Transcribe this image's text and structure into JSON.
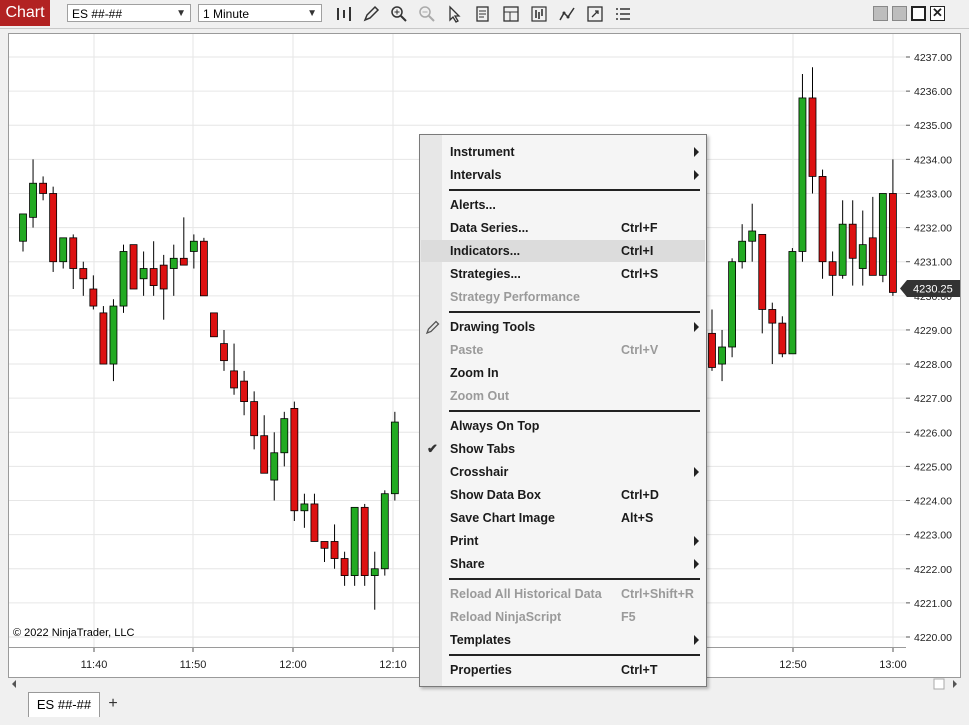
{
  "window": {
    "title": "Chart",
    "instrument": "ES ##-##",
    "interval": "1 Minute"
  },
  "toolbar": {
    "tools": [
      "bar-type-icon",
      "pencil-icon",
      "zoom-in-icon",
      "zoom-out-icon",
      "pointer-icon",
      "data-box-icon",
      "chart-panels-icon",
      "chart-style-icon",
      "indicators-icon",
      "properties-icon",
      "menu-icon"
    ]
  },
  "chart": {
    "copyright": "© 2022 NinjaTrader, LLC",
    "current_price": "4230.25",
    "colors": {
      "up": "#22aa22",
      "down": "#dd1111",
      "marker": "#333333"
    }
  },
  "chart_data": {
    "type": "candlestick",
    "instrument": "ES ##-##",
    "interval": "1 Minute",
    "x_ticks": [
      "11:40",
      "11:50",
      "12:00",
      "12:10",
      "12:50",
      "13:00"
    ],
    "y_ticks": [
      "4237.00",
      "4236.00",
      "4235.00",
      "4234.00",
      "4233.00",
      "4232.00",
      "4231.00",
      "4230.00",
      "4229.00",
      "4228.00",
      "4227.00",
      "4226.00",
      "4225.00",
      "4224.00",
      "4223.00",
      "4222.00",
      "4221.00",
      "4220.00"
    ],
    "ylim": [
      4219.8,
      4237.4
    ],
    "last_price": 4230.25,
    "candles": [
      {
        "o": 4231.6,
        "h": 4232.3,
        "l": 4231.3,
        "c": 4232.4
      },
      {
        "o": 4232.3,
        "h": 4234.0,
        "l": 4232.0,
        "c": 4233.3
      },
      {
        "o": 4233.3,
        "h": 4233.5,
        "l": 4232.8,
        "c": 4233.0
      },
      {
        "o": 4233.0,
        "h": 4233.2,
        "l": 4230.7,
        "c": 4231.0
      },
      {
        "o": 4231.0,
        "h": 4231.6,
        "l": 4230.8,
        "c": 4231.7
      },
      {
        "o": 4231.7,
        "h": 4231.8,
        "l": 4230.2,
        "c": 4230.8
      },
      {
        "o": 4230.8,
        "h": 4231.0,
        "l": 4230.0,
        "c": 4230.5
      },
      {
        "o": 4230.2,
        "h": 4230.6,
        "l": 4229.6,
        "c": 4229.7
      },
      {
        "o": 4229.5,
        "h": 4229.7,
        "l": 4228.0,
        "c": 4228.0
      },
      {
        "o": 4228.0,
        "h": 4229.9,
        "l": 4227.5,
        "c": 4229.7
      },
      {
        "o": 4229.7,
        "h": 4231.5,
        "l": 4229.5,
        "c": 4231.3
      },
      {
        "o": 4231.5,
        "h": 4231.5,
        "l": 4230.2,
        "c": 4230.2
      },
      {
        "o": 4230.5,
        "h": 4231.3,
        "l": 4230.0,
        "c": 4230.8
      },
      {
        "o": 4230.8,
        "h": 4231.6,
        "l": 4230.0,
        "c": 4230.3
      },
      {
        "o": 4230.9,
        "h": 4231.2,
        "l": 4229.3,
        "c": 4230.2
      },
      {
        "o": 4230.8,
        "h": 4231.5,
        "l": 4230.0,
        "c": 4231.1
      },
      {
        "o": 4231.1,
        "h": 4232.3,
        "l": 4231.0,
        "c": 4230.9
      },
      {
        "o": 4231.3,
        "h": 4231.8,
        "l": 4230.8,
        "c": 4231.6
      },
      {
        "o": 4231.6,
        "h": 4231.7,
        "l": 4230.0,
        "c": 4230.0
      },
      {
        "o": 4229.5,
        "h": 4229.5,
        "l": 4228.8,
        "c": 4228.8
      },
      {
        "o": 4228.6,
        "h": 4229.0,
        "l": 4227.8,
        "c": 4228.1
      },
      {
        "o": 4227.8,
        "h": 4228.6,
        "l": 4227.1,
        "c": 4227.3
      },
      {
        "o": 4227.5,
        "h": 4227.8,
        "l": 4226.5,
        "c": 4226.9
      },
      {
        "o": 4226.9,
        "h": 4227.2,
        "l": 4225.5,
        "c": 4225.9
      },
      {
        "o": 4225.9,
        "h": 4226.5,
        "l": 4224.8,
        "c": 4224.8
      },
      {
        "o": 4224.6,
        "h": 4226.0,
        "l": 4224.0,
        "c": 4225.4
      },
      {
        "o": 4225.4,
        "h": 4226.6,
        "l": 4225.0,
        "c": 4226.4
      },
      {
        "o": 4226.7,
        "h": 4226.9,
        "l": 4223.4,
        "c": 4223.7
      },
      {
        "o": 4223.7,
        "h": 4224.2,
        "l": 4223.2,
        "c": 4223.9
      },
      {
        "o": 4223.9,
        "h": 4224.2,
        "l": 4222.8,
        "c": 4222.8
      },
      {
        "o": 4222.8,
        "h": 4222.8,
        "l": 4222.2,
        "c": 4222.6
      },
      {
        "o": 4222.8,
        "h": 4223.3,
        "l": 4222.0,
        "c": 4222.3
      },
      {
        "o": 4222.3,
        "h": 4222.5,
        "l": 4221.5,
        "c": 4221.8
      },
      {
        "o": 4221.8,
        "h": 4223.8,
        "l": 4221.5,
        "c": 4223.8
      },
      {
        "o": 4223.8,
        "h": 4223.9,
        "l": 4221.5,
        "c": 4221.8
      },
      {
        "o": 4221.8,
        "h": 4222.5,
        "l": 4220.8,
        "c": 4222.0
      },
      {
        "o": 4222.0,
        "h": 4224.3,
        "l": 4221.8,
        "c": 4224.2
      },
      {
        "o": 4224.2,
        "h": 4226.6,
        "l": 4224.0,
        "c": 4226.3
      },
      {
        "o": 4228.9,
        "h": 4229.6,
        "l": 4227.8,
        "c": 4227.9
      },
      {
        "o": 4228.0,
        "h": 4229.0,
        "l": 4227.5,
        "c": 4228.5
      },
      {
        "o": 4228.5,
        "h": 4231.1,
        "l": 4228.2,
        "c": 4231.0
      },
      {
        "o": 4231.0,
        "h": 4232.1,
        "l": 4230.8,
        "c": 4231.6
      },
      {
        "o": 4231.6,
        "h": 4232.7,
        "l": 4231.0,
        "c": 4231.9
      },
      {
        "o": 4231.8,
        "h": 4231.8,
        "l": 4228.9,
        "c": 4229.6
      },
      {
        "o": 4229.6,
        "h": 4229.8,
        "l": 4228.0,
        "c": 4229.2
      },
      {
        "o": 4229.2,
        "h": 4229.4,
        "l": 4228.2,
        "c": 4228.3
      },
      {
        "o": 4228.3,
        "h": 4231.4,
        "l": 4228.3,
        "c": 4231.3
      },
      {
        "o": 4231.3,
        "h": 4236.5,
        "l": 4231.0,
        "c": 4235.8
      },
      {
        "o": 4235.8,
        "h": 4236.7,
        "l": 4233.0,
        "c": 4233.5
      },
      {
        "o": 4233.5,
        "h": 4233.7,
        "l": 4230.5,
        "c": 4231.0
      },
      {
        "o": 4231.0,
        "h": 4231.3,
        "l": 4230.0,
        "c": 4230.6
      },
      {
        "o": 4230.6,
        "h": 4232.8,
        "l": 4230.5,
        "c": 4232.1
      },
      {
        "o": 4232.1,
        "h": 4232.8,
        "l": 4230.3,
        "c": 4231.1
      },
      {
        "o": 4230.8,
        "h": 4232.5,
        "l": 4230.3,
        "c": 4231.5
      },
      {
        "o": 4231.7,
        "h": 4232.9,
        "l": 4230.6,
        "c": 4230.6
      },
      {
        "o": 4230.6,
        "h": 4233.0,
        "l": 4230.4,
        "c": 4233.0
      },
      {
        "o": 4233.0,
        "h": 4234.0,
        "l": 4230.0,
        "c": 4230.1
      }
    ]
  },
  "menu": {
    "items": [
      {
        "label": "Instrument",
        "shortcut": "",
        "submenu": true,
        "disabled": false
      },
      {
        "label": "Intervals",
        "shortcut": "",
        "submenu": true,
        "disabled": false
      },
      {
        "label": "Alerts...",
        "shortcut": "",
        "submenu": false,
        "disabled": false
      },
      {
        "label": "Data Series...",
        "shortcut": "Ctrl+F",
        "submenu": false,
        "disabled": false
      },
      {
        "label": "Indicators...",
        "shortcut": "Ctrl+I",
        "submenu": false,
        "disabled": false,
        "highlighted": true
      },
      {
        "label": "Strategies...",
        "shortcut": "Ctrl+S",
        "submenu": false,
        "disabled": false
      },
      {
        "label": "Strategy Performance",
        "shortcut": "",
        "submenu": false,
        "disabled": true
      },
      {
        "label": "Drawing Tools",
        "shortcut": "",
        "submenu": true,
        "disabled": false,
        "icon": "pencil-icon"
      },
      {
        "label": "Paste",
        "shortcut": "Ctrl+V",
        "submenu": false,
        "disabled": true
      },
      {
        "label": "Zoom In",
        "shortcut": "",
        "submenu": false,
        "disabled": false
      },
      {
        "label": "Zoom Out",
        "shortcut": "",
        "submenu": false,
        "disabled": true
      },
      {
        "label": "Always On Top",
        "shortcut": "",
        "submenu": false,
        "disabled": false
      },
      {
        "label": "Show Tabs",
        "shortcut": "",
        "submenu": false,
        "disabled": false,
        "checked": true
      },
      {
        "label": "Crosshair",
        "shortcut": "",
        "submenu": true,
        "disabled": false
      },
      {
        "label": "Show Data Box",
        "shortcut": "Ctrl+D",
        "submenu": false,
        "disabled": false
      },
      {
        "label": "Save Chart Image",
        "shortcut": "Alt+S",
        "submenu": false,
        "disabled": false
      },
      {
        "label": "Print",
        "shortcut": "",
        "submenu": true,
        "disabled": false
      },
      {
        "label": "Share",
        "shortcut": "",
        "submenu": true,
        "disabled": false
      },
      {
        "label": "Reload All Historical Data",
        "shortcut": "Ctrl+Shift+R",
        "submenu": false,
        "disabled": true
      },
      {
        "label": "Reload NinjaScript",
        "shortcut": "F5",
        "submenu": false,
        "disabled": true
      },
      {
        "label": "Templates",
        "shortcut": "",
        "submenu": true,
        "disabled": false
      },
      {
        "label": "Properties",
        "shortcut": "Ctrl+T",
        "submenu": false,
        "disabled": false
      }
    ]
  },
  "tabs": {
    "items": [
      "ES ##-##"
    ],
    "add_label": "+"
  }
}
